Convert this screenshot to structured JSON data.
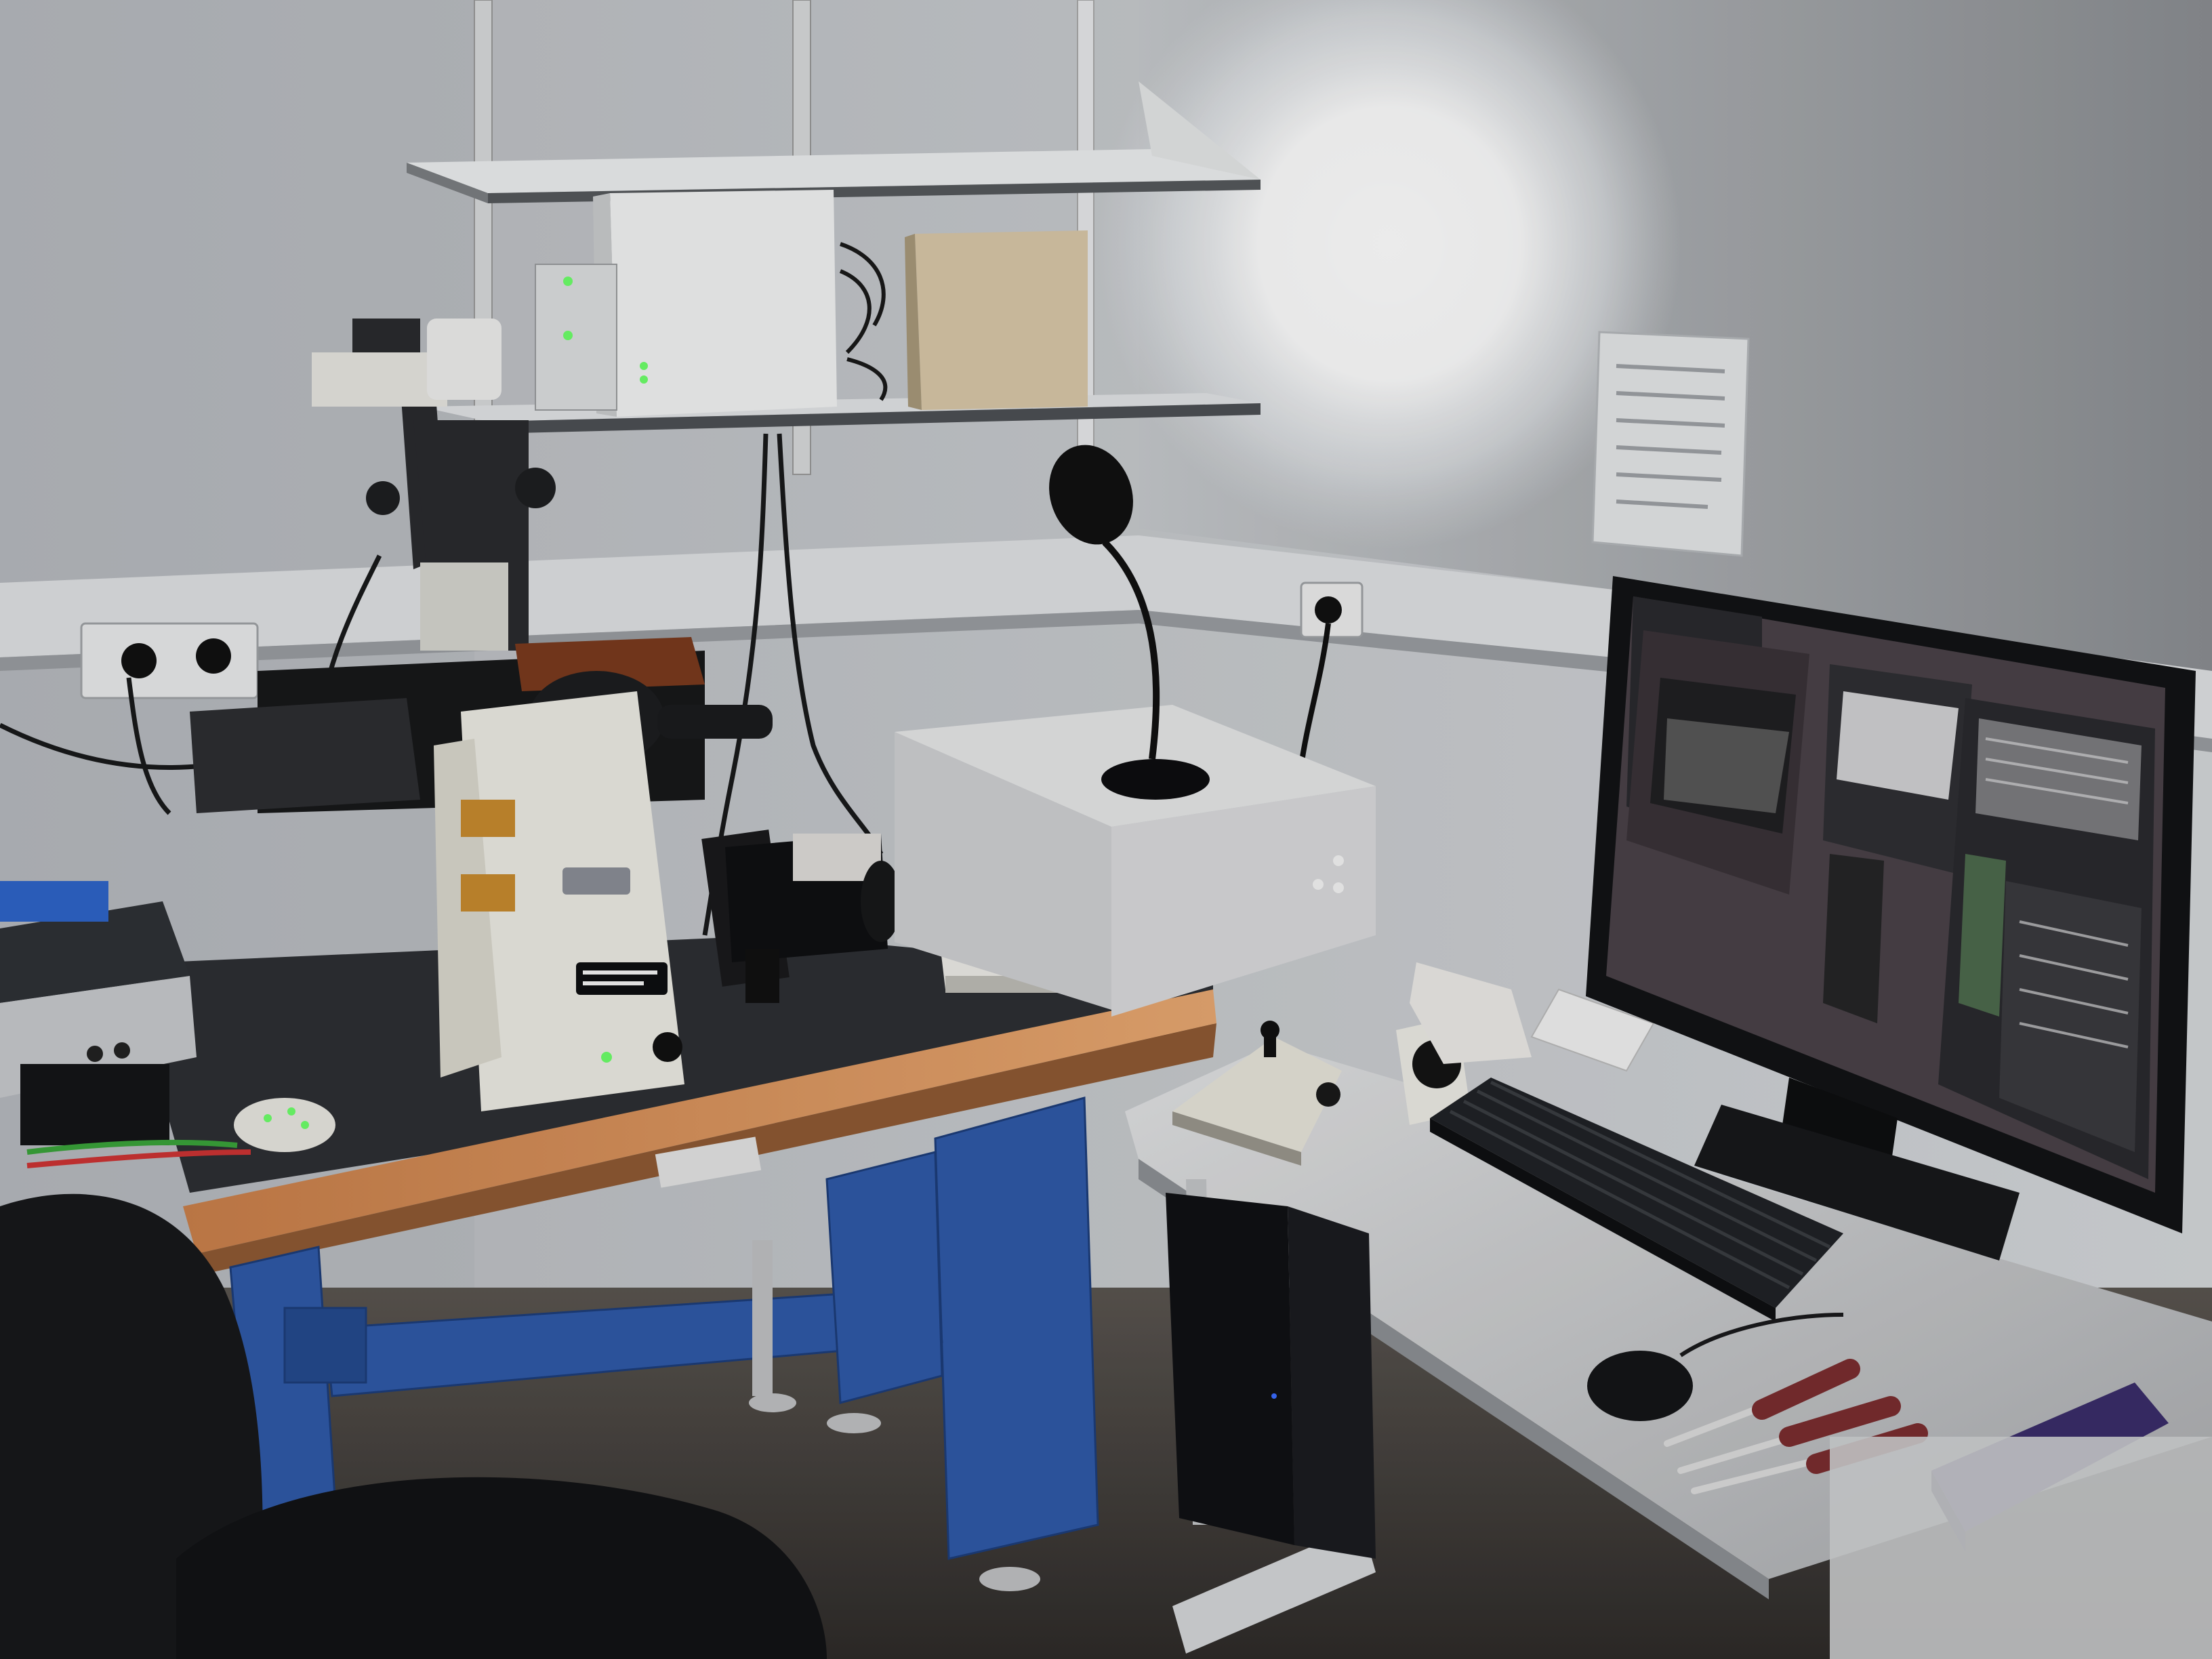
{
  "scene": {
    "kind": "photograph",
    "subject": "microscope-workstation",
    "colors": {
      "wall": "#c9ccd0",
      "wall_shadow": "#6d7074",
      "floor": "#4a4642",
      "table_frame": "#2f5aa8",
      "table_edge": "#d8925a",
      "bench_top": "#2d2f33",
      "desk_top": "#d6d8da",
      "microscope_body": "#e9e6dc",
      "monitor_bezel": "#121315",
      "screen_bg": "#4a4248",
      "panel_bg": "#2a2a2e",
      "led_green": "#6dff6a",
      "lamp_glow": "#ffffff",
      "chair": "#17181b",
      "pipette_rack": "#3a2d6a"
    },
    "icons": {
      "lamp": "desk-lamp-icon",
      "keyboard": "keyboard-icon",
      "mouse": "mouse-icon",
      "monitor": "monitor-icon",
      "chair": "chair-icon"
    }
  }
}
